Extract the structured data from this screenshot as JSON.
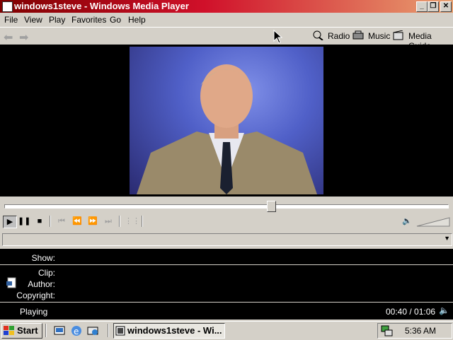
{
  "window": {
    "title": "windows1steve - Windows Media Player",
    "caption_buttons": {
      "minimize": "_",
      "restore": "❐",
      "close": "✕"
    }
  },
  "menu": [
    "File",
    "View",
    "Play",
    "Favorites",
    "Go",
    "Help"
  ],
  "nav": {
    "back_icon": "back-arrow-icon",
    "forward_icon": "forward-arrow-icon",
    "links": [
      {
        "label": "Radio",
        "icon": "radio-icon"
      },
      {
        "label": "Music",
        "icon": "music-icon"
      },
      {
        "label": "Media Guide",
        "icon": "media-guide-icon"
      }
    ]
  },
  "playback": {
    "seek_progress": 0.6,
    "status": "Playing",
    "time": "00:40 / 01:06"
  },
  "info": {
    "show_label": "Show:",
    "show_value": "",
    "clip_label": "Clip:",
    "clip_value": "",
    "author_label": "Author:",
    "author_value": "",
    "copyright_label": "Copyright:",
    "copyright_value": ""
  },
  "taskbar": {
    "start_label": "Start",
    "task_button": "windows1steve - Wi...",
    "clock": "5:36 AM"
  },
  "colors": {
    "titlebar_start": "#7f0000",
    "titlebar_end": "#e8a070",
    "chrome": "#d4d0c8",
    "video_bg": "#000000"
  }
}
